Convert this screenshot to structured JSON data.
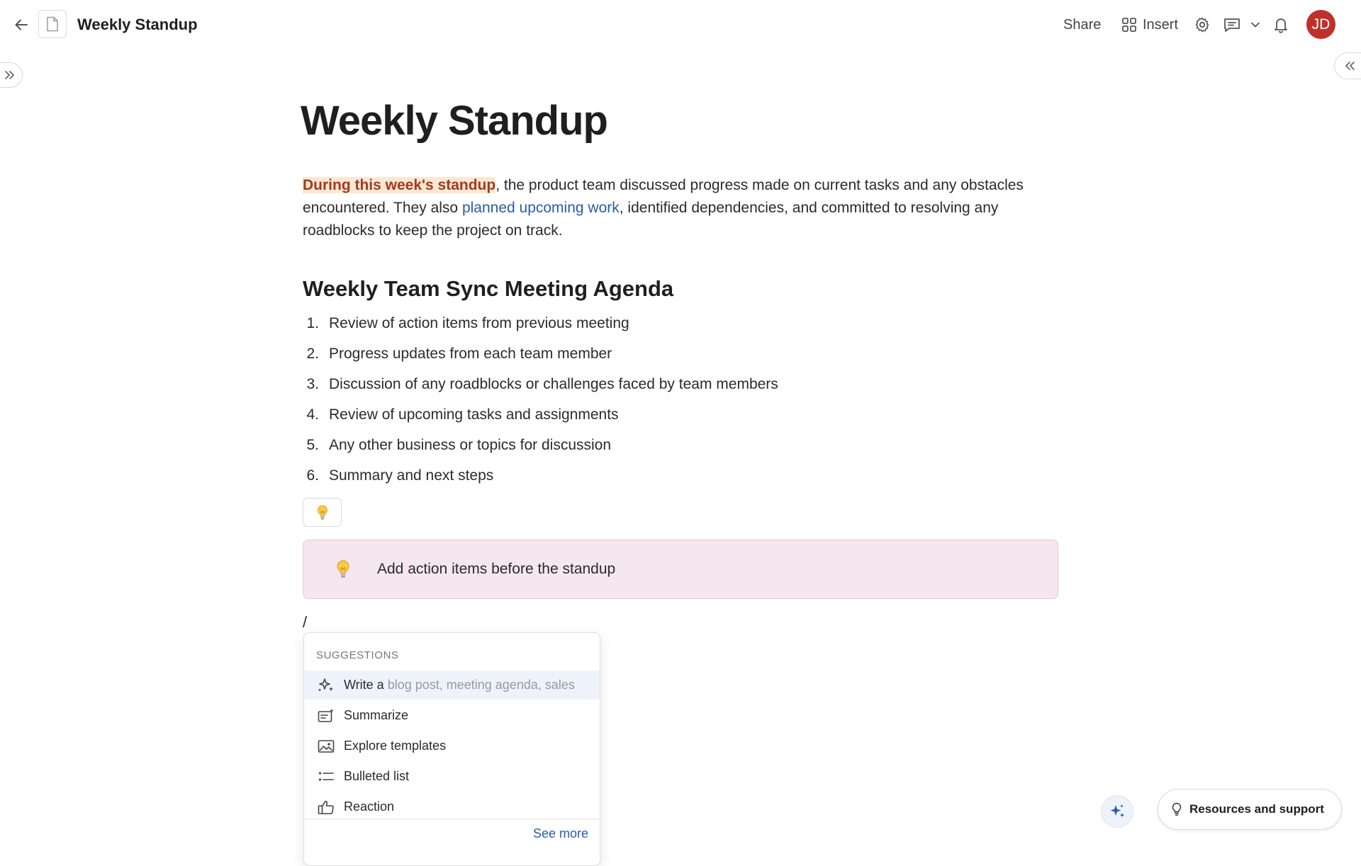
{
  "header": {
    "doc_title": "Weekly Standup",
    "share_label": "Share",
    "insert_label": "Insert",
    "avatar_initials": "JD",
    "avatar_color": "#c0302a"
  },
  "document": {
    "title": "Weekly Standup",
    "intro": {
      "highlight": "During this week's standup",
      "text1": ", the product team discussed progress made on current tasks and any obstacles encountered. They also ",
      "link": "planned upcoming work",
      "text2": ", identified dependencies, and committed to resolving any roadblocks to keep the project on track."
    },
    "agenda_heading": "Weekly Team Sync Meeting Agenda",
    "agenda": [
      {
        "num": "1.",
        "text": "Review of action items from previous meeting"
      },
      {
        "num": "2.",
        "text": "Progress updates from each team member"
      },
      {
        "num": "3.",
        "text": "Discussion of any roadblocks or challenges faced by team members"
      },
      {
        "num": "4.",
        "text": "Review of upcoming tasks and assignments"
      },
      {
        "num": "5.",
        "text": "Any other business or topics for discussion"
      },
      {
        "num": "6.",
        "text": "Summary and next steps"
      }
    ],
    "callout_text": "Add action items before the standup",
    "slash_text": "/"
  },
  "suggestions": {
    "header": "SUGGESTIONS",
    "items": [
      {
        "label": "Write a",
        "placeholder": " blog post, meeting agenda, sales",
        "icon": "sparkle-icon"
      },
      {
        "label": "Summarize",
        "icon": "summarize-icon"
      },
      {
        "label": "Explore templates",
        "icon": "image-icon"
      },
      {
        "label": "Bulleted list",
        "icon": "bulleted-list-icon"
      },
      {
        "label": "Reaction",
        "icon": "thumbs-up-icon"
      }
    ],
    "see_more": "See more"
  },
  "footer": {
    "resources_label": "Resources and support"
  },
  "colors": {
    "highlight_bg": "#fbe8d4",
    "highlight_text": "#a33a22",
    "link": "#2b5ca8",
    "callout_bg": "#f5e6ef"
  }
}
